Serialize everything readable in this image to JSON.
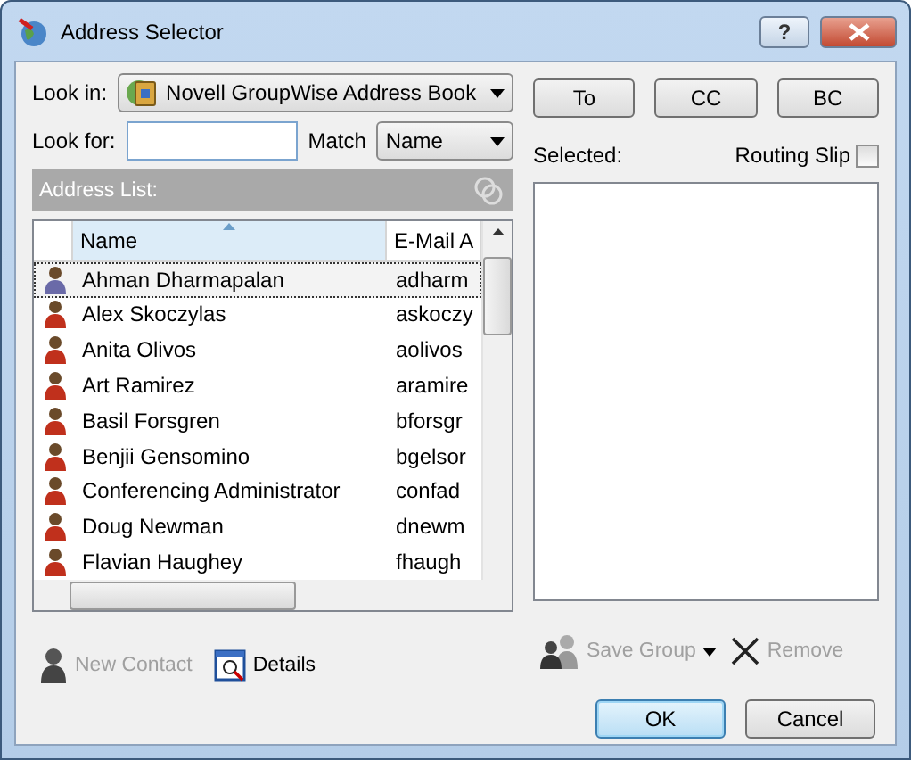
{
  "window": {
    "title": "Address Selector",
    "buttons": [
      "?"
    ]
  },
  "look_in": {
    "label": "Look in:",
    "value": "Novell GroupWise Address Book"
  },
  "look_for": {
    "label": "Look for:"
  },
  "match": {
    "label": "Match",
    "value": "Name"
  },
  "address_list": {
    "title": "Address List:",
    "columns": [
      {
        "label": "Name",
        "sorted": true
      },
      {
        "label": "E-Mail A",
        "sorted": false
      }
    ],
    "rows": [
      {
        "name": "Ahman Dharmapalan",
        "email": "adharm",
        "selected": true
      },
      {
        "name": "Alex Skoczylas",
        "email": "askoczy",
        "selected": false
      },
      {
        "name": "Anita Olivos",
        "email": "aolivos",
        "selected": false
      },
      {
        "name": "Art Ramirez",
        "email": "aramire",
        "selected": false
      },
      {
        "name": "Basil Forsgren",
        "email": "bforsgr",
        "selected": false
      },
      {
        "name": "Benjii Gensomino",
        "email": "bgelsor",
        "selected": false
      },
      {
        "name": "Conferencing Administrator",
        "email": "confad",
        "selected": false
      },
      {
        "name": "Doug Newman",
        "email": "dnewm",
        "selected": false
      },
      {
        "name": "Flavian Haughey",
        "email": "fhaugh",
        "selected": false
      }
    ]
  },
  "recipient_buttons": [
    "To",
    "CC",
    "BC"
  ],
  "selected_label": "Selected:",
  "routing_slip": {
    "label": "Routing Slip",
    "checked": false
  },
  "left_actions": [
    {
      "label": "New Contact",
      "disabled": true,
      "kind": "person"
    },
    {
      "label": "Details",
      "disabled": false,
      "kind": "details"
    }
  ],
  "right_actions": [
    {
      "label": "Save Group",
      "disabled": true,
      "kind": "group"
    },
    {
      "label": "Remove",
      "disabled": true,
      "kind": "remove"
    }
  ],
  "dialog_buttons": [
    {
      "label": "OK",
      "default": true
    },
    {
      "label": "Cancel",
      "default": false
    }
  ]
}
